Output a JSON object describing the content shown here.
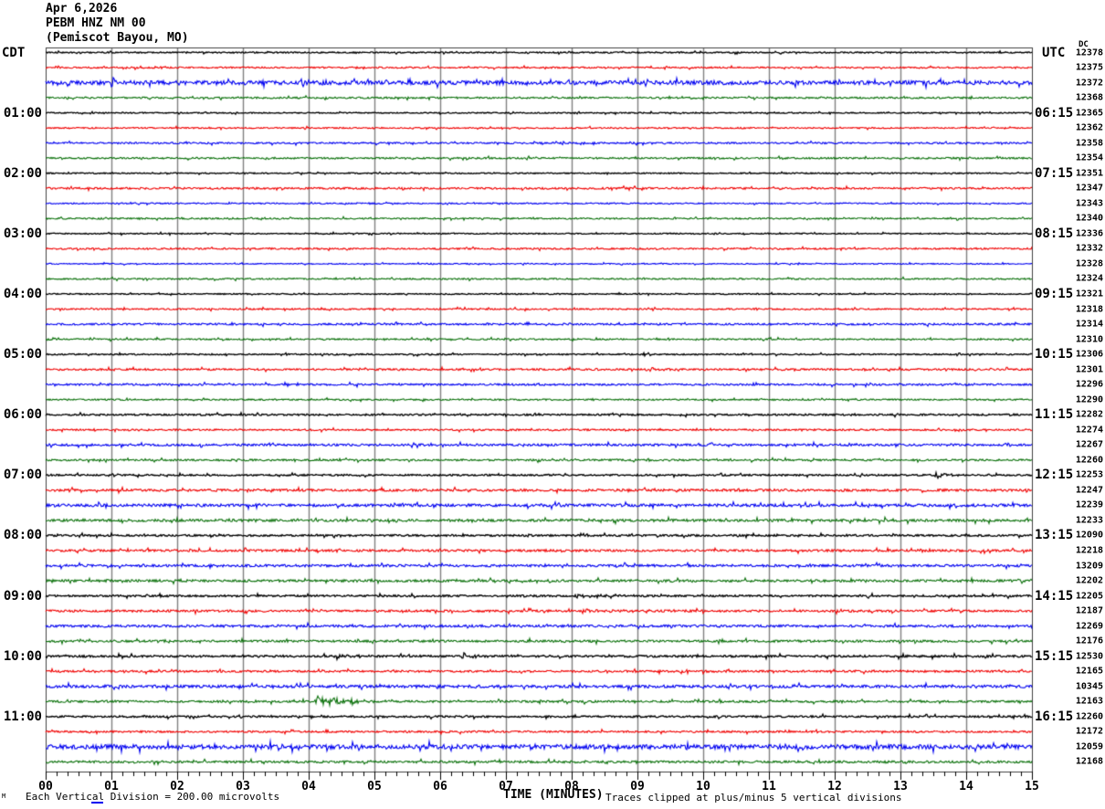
{
  "title": {
    "date": "Apr 6,2026",
    "station": "PEBM HNZ NM 00",
    "location": "(Pemiscot Bayou, MO)"
  },
  "axes": {
    "left_timezone": "CDT",
    "right_timezone": "UTC",
    "dc_header": "DC",
    "x_label": "TIME (MINUTES)",
    "x_ticks": [
      "00",
      "01",
      "02",
      "03",
      "04",
      "05",
      "06",
      "07",
      "08",
      "09",
      "10",
      "11",
      "12",
      "13",
      "14",
      "15"
    ]
  },
  "footer": {
    "scale_note": "Each Vertical Division =  200.00 microvolts",
    "clip_note": "Traces clipped at plus/minus 5 vertical divisions",
    "corner_mark": "M"
  },
  "left_time_labels": [
    "01:00",
    "02:00",
    "03:00",
    "04:00",
    "05:00",
    "06:00",
    "07:00",
    "08:00",
    "09:00",
    "10:00",
    "11:00"
  ],
  "right_time_labels": [
    "06:15",
    "07:15",
    "08:15",
    "09:15",
    "10:15",
    "11:15",
    "12:15",
    "13:15",
    "14:15",
    "15:15",
    "16:15"
  ],
  "colors": {
    "black": "#000000",
    "red": "#f00000",
    "blue": "#0000f0",
    "green": "#0a700a",
    "grid": "#808080",
    "border": "#404040"
  },
  "chart_data": {
    "type": "line",
    "subtype": "helicorder-seismogram",
    "title": "PEBM HNZ NM 00 (Pemiscot Bayou, MO) Apr 6,2026",
    "xlabel": "TIME (MINUTES)",
    "x_range": [
      0,
      15
    ],
    "minutes_per_line": 15,
    "minor_ticks_per_minute": 6,
    "grid": "vertical-only",
    "trace_color_cycle": [
      "#000000",
      "#f00000",
      "#0000f0",
      "#0a700a"
    ],
    "traces": [
      {
        "start_cdt": "00:00",
        "dc": "12378",
        "amp": 0.7,
        "events": []
      },
      {
        "start_cdt": "00:15",
        "dc": "12375",
        "amp": 0.8,
        "events": []
      },
      {
        "start_cdt": "00:30",
        "dc": "12372",
        "amp": 2.2,
        "events": []
      },
      {
        "start_cdt": "00:45",
        "dc": "12368",
        "amp": 0.9,
        "events": []
      },
      {
        "start_cdt": "01:00",
        "dc": "12365",
        "amp": 0.6,
        "events": []
      },
      {
        "start_cdt": "01:15",
        "dc": "12362",
        "amp": 0.7,
        "events": []
      },
      {
        "start_cdt": "01:30",
        "dc": "12358",
        "amp": 0.9,
        "events": []
      },
      {
        "start_cdt": "01:45",
        "dc": "12354",
        "amp": 0.9,
        "events": []
      },
      {
        "start_cdt": "02:00",
        "dc": "12351",
        "amp": 0.6,
        "events": []
      },
      {
        "start_cdt": "02:15",
        "dc": "12347",
        "amp": 1.0,
        "events": []
      },
      {
        "start_cdt": "02:30",
        "dc": "12343",
        "amp": 0.7,
        "events": []
      },
      {
        "start_cdt": "02:45",
        "dc": "12340",
        "amp": 0.8,
        "events": []
      },
      {
        "start_cdt": "03:00",
        "dc": "12336",
        "amp": 0.6,
        "events": []
      },
      {
        "start_cdt": "03:15",
        "dc": "12332",
        "amp": 0.9,
        "events": []
      },
      {
        "start_cdt": "03:30",
        "dc": "12328",
        "amp": 0.6,
        "events": []
      },
      {
        "start_cdt": "03:45",
        "dc": "12324",
        "amp": 0.8,
        "events": []
      },
      {
        "start_cdt": "04:00",
        "dc": "12321",
        "amp": 0.6,
        "events": []
      },
      {
        "start_cdt": "04:15",
        "dc": "12318",
        "amp": 0.8,
        "events": []
      },
      {
        "start_cdt": "04:30",
        "dc": "12314",
        "amp": 1.0,
        "events": []
      },
      {
        "start_cdt": "04:45",
        "dc": "12310",
        "amp": 0.8,
        "events": []
      },
      {
        "start_cdt": "05:00",
        "dc": "12306",
        "amp": 0.7,
        "events": []
      },
      {
        "start_cdt": "05:15",
        "dc": "12301",
        "amp": 1.0,
        "events": [
          {
            "t": 9.2,
            "a": 2.2,
            "w": 0.15
          }
        ]
      },
      {
        "start_cdt": "05:30",
        "dc": "12296",
        "amp": 1.0,
        "events": []
      },
      {
        "start_cdt": "05:45",
        "dc": "12290",
        "amp": 0.8,
        "events": []
      },
      {
        "start_cdt": "06:00",
        "dc": "12282",
        "amp": 0.9,
        "events": []
      },
      {
        "start_cdt": "06:15",
        "dc": "12274",
        "amp": 0.9,
        "events": []
      },
      {
        "start_cdt": "06:30",
        "dc": "12267",
        "amp": 1.2,
        "events": []
      },
      {
        "start_cdt": "06:45",
        "dc": "12260",
        "amp": 1.0,
        "events": []
      },
      {
        "start_cdt": "07:00",
        "dc": "12253",
        "amp": 0.9,
        "events": [
          {
            "t": 13.55,
            "a": 2.8,
            "w": 0.3
          }
        ]
      },
      {
        "start_cdt": "07:15",
        "dc": "12247",
        "amp": 1.3,
        "events": []
      },
      {
        "start_cdt": "07:30",
        "dc": "12239",
        "amp": 1.5,
        "events": []
      },
      {
        "start_cdt": "07:45",
        "dc": "12233",
        "amp": 1.4,
        "events": []
      },
      {
        "start_cdt": "08:00",
        "dc": "12090",
        "amp": 1.0,
        "events": []
      },
      {
        "start_cdt": "08:15",
        "dc": "12218",
        "amp": 1.2,
        "events": []
      },
      {
        "start_cdt": "08:30",
        "dc": "13209",
        "amp": 1.3,
        "events": []
      },
      {
        "start_cdt": "08:45",
        "dc": "12202",
        "amp": 1.3,
        "events": []
      },
      {
        "start_cdt": "09:00",
        "dc": "12205",
        "amp": 1.0,
        "events": [
          {
            "t": 8.1,
            "a": 2.4,
            "w": 0.35
          }
        ]
      },
      {
        "start_cdt": "09:15",
        "dc": "12187",
        "amp": 1.2,
        "events": [
          {
            "t": 8.15,
            "a": 3.2,
            "w": 0.25
          }
        ]
      },
      {
        "start_cdt": "09:30",
        "dc": "12269",
        "amp": 1.3,
        "events": []
      },
      {
        "start_cdt": "09:45",
        "dc": "12176",
        "amp": 1.2,
        "events": []
      },
      {
        "start_cdt": "10:00",
        "dc": "12530",
        "amp": 1.1,
        "events": [
          {
            "t": 4.4,
            "a": 2.8,
            "w": 0.3
          },
          {
            "t": 6.35,
            "a": 4.2,
            "w": 0.12
          }
        ]
      },
      {
        "start_cdt": "10:15",
        "dc": "12165",
        "amp": 1.1,
        "events": []
      },
      {
        "start_cdt": "10:30",
        "dc": "10345",
        "amp": 1.5,
        "events": []
      },
      {
        "start_cdt": "10:45",
        "dc": "12163",
        "amp": 1.1,
        "events": [
          {
            "t": 4.15,
            "a": 6.5,
            "w": 0.4
          }
        ]
      },
      {
        "start_cdt": "11:00",
        "dc": "12260",
        "amp": 1.0,
        "events": []
      },
      {
        "start_cdt": "11:15",
        "dc": "12172",
        "amp": 1.0,
        "events": []
      },
      {
        "start_cdt": "11:30",
        "dc": "12059",
        "amp": 2.4,
        "events": [
          {
            "t": 3.55,
            "a": 3.8,
            "w": 0.2
          }
        ]
      },
      {
        "start_cdt": "11:45",
        "dc": "12168",
        "amp": 1.2,
        "events": []
      }
    ]
  }
}
